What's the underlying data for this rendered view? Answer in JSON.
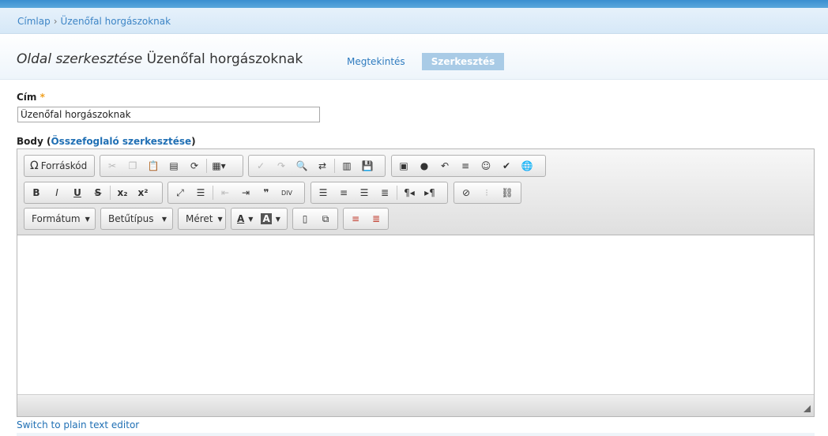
{
  "breadcrumb": {
    "home": "Címlap",
    "separator": "›",
    "current": "Üzenőfal horgászoknak"
  },
  "page": {
    "title_prefix": "Oldal szerkesztése",
    "title_node": "Üzenőfal horgászoknak"
  },
  "tabs": {
    "view": "Megtekintés",
    "edit": "Szerkesztés"
  },
  "form": {
    "title_label": "Cím",
    "required_mark": "*",
    "title_value": "Üzenőfal horgászoknak",
    "body_label": "Body",
    "body_paren_open": "(",
    "summary_link": "Összefoglaló szerkesztése",
    "body_paren_close": ")"
  },
  "toolbar": {
    "source_label": "Forráskód",
    "format_combo": "Formátum",
    "font_combo": "Betűtípus",
    "size_combo": "Méret",
    "text_color": "A",
    "bg_color": "A"
  },
  "editor": {
    "switch_link": "Switch to plain text editor"
  }
}
